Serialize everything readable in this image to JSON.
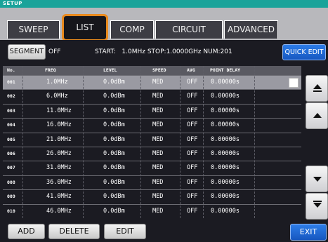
{
  "header": {
    "title": "SETUP"
  },
  "tabs": [
    {
      "label": "SWEEP",
      "active": false
    },
    {
      "label": "LIST",
      "active": true
    },
    {
      "label": "COMP",
      "active": false
    },
    {
      "label": "CIRCUIT",
      "active": false
    },
    {
      "label": "ADVANCED",
      "active": false
    }
  ],
  "segment": {
    "label": "SEGMENT",
    "state": "OFF"
  },
  "sweep_info": "START:   1.0MHz STOP:1.0000GHz NUM:201",
  "quick_edit_label": "QUICK EDIT",
  "table": {
    "headers": [
      "No.",
      "FREQ",
      "LEVEL",
      "SPEED",
      "AVG",
      "POINT DELAY"
    ],
    "rows": [
      [
        "001",
        "1.0MHz",
        "0.0dBm",
        "MED",
        "OFF",
        "0.00000s"
      ],
      [
        "002",
        "6.0MHz",
        "0.0dBm",
        "MED",
        "OFF",
        "0.00000s"
      ],
      [
        "003",
        "11.0MHz",
        "0.0dBm",
        "MED",
        "OFF",
        "0.00000s"
      ],
      [
        "004",
        "16.0MHz",
        "0.0dBm",
        "MED",
        "OFF",
        "0.00000s"
      ],
      [
        "005",
        "21.0MHz",
        "0.0dBm",
        "MED",
        "OFF",
        "0.00000s"
      ],
      [
        "006",
        "26.0MHz",
        "0.0dBm",
        "MED",
        "OFF",
        "0.00000s"
      ],
      [
        "007",
        "31.0MHz",
        "0.0dBm",
        "MED",
        "OFF",
        "0.00000s"
      ],
      [
        "008",
        "36.0MHz",
        "0.0dBm",
        "MED",
        "OFF",
        "0.00000s"
      ],
      [
        "009",
        "41.0MHz",
        "0.0dBm",
        "MED",
        "OFF",
        "0.00000s"
      ],
      [
        "010",
        "46.0MHz",
        "0.0dBm",
        "MED",
        "OFF",
        "0.00000s"
      ]
    ],
    "selected_row": 0
  },
  "bottom": {
    "add": "ADD",
    "delete": "DELETE",
    "edit": "EDIT",
    "exit": "EXIT"
  },
  "icons": {
    "scroll_top": "scroll-top-icon",
    "scroll_up": "scroll-up-icon",
    "scroll_down": "scroll-down-icon",
    "scroll_bottom": "scroll-bottom-icon"
  },
  "colors": {
    "accent_tab": "#e88a1e",
    "header": "#1aa39a",
    "blue_button": "#1f6bd6"
  }
}
